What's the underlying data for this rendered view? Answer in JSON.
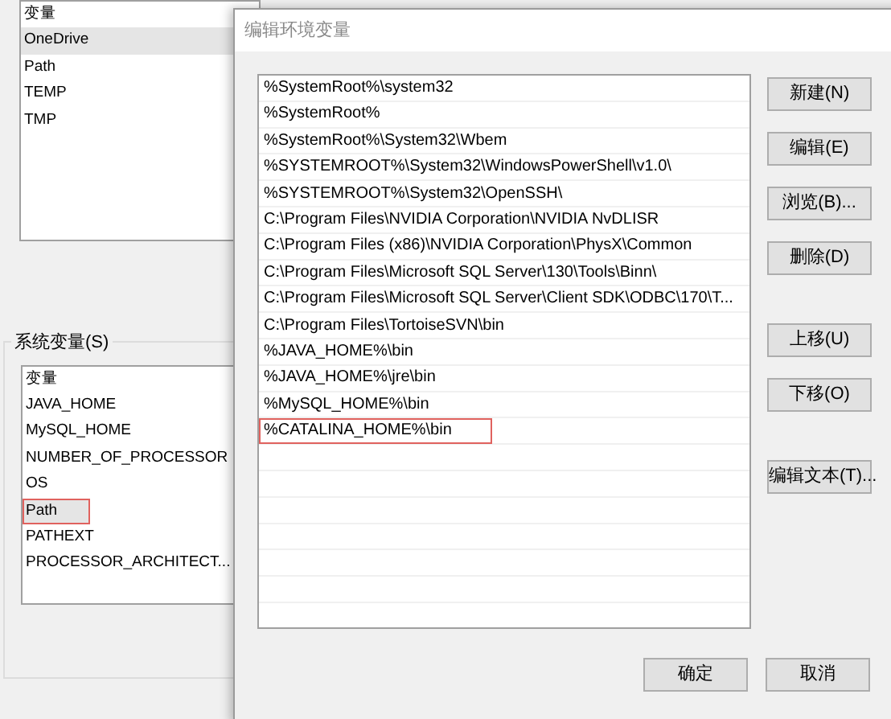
{
  "background_window": {
    "user_variables": {
      "header": "变量",
      "rows": [
        {
          "name": "OneDrive",
          "selected": true,
          "highlighted": false
        },
        {
          "name": "Path",
          "selected": false,
          "highlighted": false
        },
        {
          "name": "TEMP",
          "selected": false,
          "highlighted": false
        },
        {
          "name": "TMP",
          "selected": false,
          "highlighted": false
        }
      ]
    },
    "system_variables": {
      "label": "系统变量(S)",
      "header": "变量",
      "rows": [
        {
          "name": "JAVA_HOME",
          "selected": false,
          "highlighted": false
        },
        {
          "name": "MySQL_HOME",
          "selected": false,
          "highlighted": false
        },
        {
          "name": "NUMBER_OF_PROCESSOR",
          "selected": false,
          "highlighted": false
        },
        {
          "name": "OS",
          "selected": false,
          "highlighted": false
        },
        {
          "name": "Path",
          "selected": true,
          "highlighted": true
        },
        {
          "name": "PATHEXT",
          "selected": false,
          "highlighted": false
        },
        {
          "name": "PROCESSOR_ARCHITECT...",
          "selected": false,
          "highlighted": false
        }
      ]
    }
  },
  "dialog": {
    "title": "编辑环境变量",
    "entries": [
      {
        "text": "%SystemRoot%\\system32",
        "selected": false,
        "highlighted": false
      },
      {
        "text": "%SystemRoot%",
        "selected": false,
        "highlighted": false
      },
      {
        "text": "%SystemRoot%\\System32\\Wbem",
        "selected": false,
        "highlighted": false
      },
      {
        "text": "%SYSTEMROOT%\\System32\\WindowsPowerShell\\v1.0\\",
        "selected": false,
        "highlighted": false
      },
      {
        "text": "%SYSTEMROOT%\\System32\\OpenSSH\\",
        "selected": false,
        "highlighted": false
      },
      {
        "text": "C:\\Program Files\\NVIDIA Corporation\\NVIDIA NvDLISR",
        "selected": false,
        "highlighted": false
      },
      {
        "text": "C:\\Program Files (x86)\\NVIDIA Corporation\\PhysX\\Common",
        "selected": false,
        "highlighted": false
      },
      {
        "text": "C:\\Program Files\\Microsoft SQL Server\\130\\Tools\\Binn\\",
        "selected": false,
        "highlighted": false
      },
      {
        "text": "C:\\Program Files\\Microsoft SQL Server\\Client SDK\\ODBC\\170\\T...",
        "selected": false,
        "highlighted": false
      },
      {
        "text": "C:\\Program Files\\TortoiseSVN\\bin",
        "selected": false,
        "highlighted": false
      },
      {
        "text": "%JAVA_HOME%\\bin",
        "selected": false,
        "highlighted": false
      },
      {
        "text": "%JAVA_HOME%\\jre\\bin",
        "selected": false,
        "highlighted": false
      },
      {
        "text": "%MySQL_HOME%\\bin",
        "selected": false,
        "highlighted": false
      },
      {
        "text": "%CATALINA_HOME%\\bin",
        "selected": false,
        "highlighted": true
      }
    ],
    "side_button_groups": [
      [
        "新建(N)",
        "编辑(E)",
        "浏览(B)...",
        "删除(D)"
      ],
      [
        "上移(U)",
        "下移(O)"
      ],
      [
        "编辑文本(T)..."
      ]
    ],
    "bottom_buttons": [
      "确定",
      "取消"
    ]
  }
}
